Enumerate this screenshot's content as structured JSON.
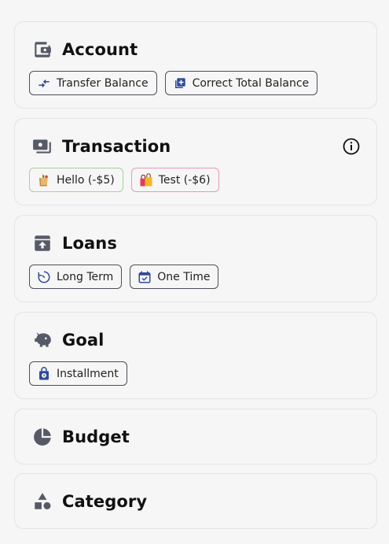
{
  "sections": {
    "account": {
      "title": "Account",
      "icon": "wallet-icon",
      "actions": [
        {
          "label": "Transfer Balance",
          "icon": "transfer-arrows-icon"
        },
        {
          "label": "Correct Total Balance",
          "icon": "add-box-icon"
        }
      ]
    },
    "transaction": {
      "title": "Transaction",
      "icon": "money-stack-icon",
      "info_icon": "info-circle-icon",
      "actions": [
        {
          "label": "Hello (-$5)",
          "icon": "grocery-bag-emoji",
          "border_color": "#a8d19a"
        },
        {
          "label": "Test (-$6)",
          "icon": "shopping-bags-emoji",
          "border_color": "#e69ab5"
        }
      ]
    },
    "loans": {
      "title": "Loans",
      "icon": "archive-upload-icon",
      "actions": [
        {
          "label": "Long Term",
          "icon": "timer-refresh-icon"
        },
        {
          "label": "One Time",
          "icon": "calendar-check-icon"
        }
      ]
    },
    "goal": {
      "title": "Goal",
      "icon": "piggy-bank-icon",
      "actions": [
        {
          "label": "Installment",
          "icon": "lock-clock-icon"
        }
      ]
    },
    "budget": {
      "title": "Budget",
      "icon": "pie-chart-icon"
    },
    "category": {
      "title": "Category",
      "icon": "shapes-icon"
    }
  },
  "colors": {
    "background": "#f6f6f6",
    "card_border": "#e4e4e4",
    "icon_gray": "#555a66",
    "chip_icon_blue": "#2f4a9a",
    "chip_border": "#4b4f57"
  }
}
